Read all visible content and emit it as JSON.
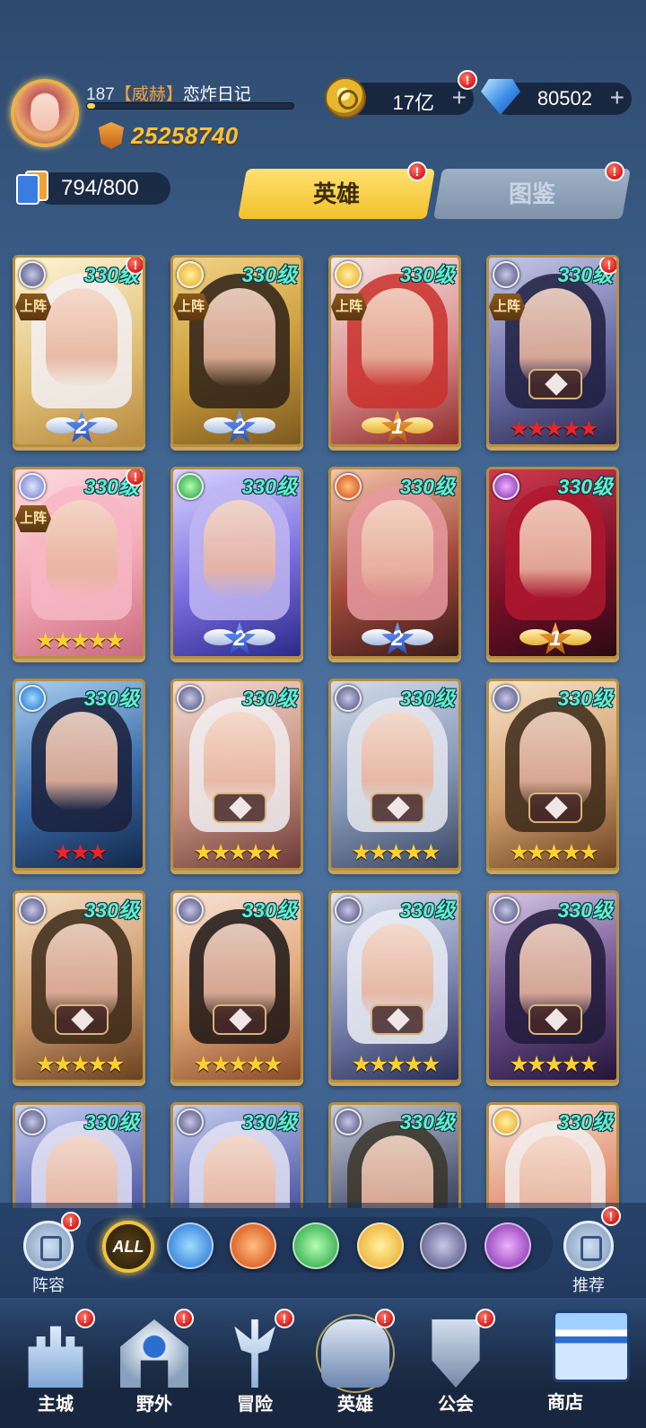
{
  "player": {
    "level": "187",
    "guild_tag": "【威赫】",
    "name": "恋炸日记",
    "xp_fraction": 0.04,
    "power": "25258740"
  },
  "currency": {
    "gold": "17亿",
    "gems": "80502",
    "plus": "+"
  },
  "collection": {
    "count": "794/800"
  },
  "tabs": [
    {
      "label": "英雄",
      "active": true
    },
    {
      "label": "图鉴",
      "active": false
    }
  ],
  "alert_glyph": "!",
  "heroes": [
    {
      "level": "330级",
      "element": "void-icon",
      "deployed": true,
      "deploy_label": "上阵",
      "rank_badge": "silver",
      "rank": "2",
      "alert": true,
      "tint": "#fff5d6,#e2c27a,#b88940",
      "hair": "#f3f1f6"
    },
    {
      "level": "330级",
      "element": "light-icon",
      "deployed": true,
      "deploy_label": "上阵",
      "rank_badge": "silver",
      "rank": "2",
      "alert": false,
      "tint": "#f2d48a,#c99a38,#7b5a20",
      "hair": "#2b2018"
    },
    {
      "level": "330级",
      "element": "light-icon",
      "deployed": true,
      "deploy_label": "上阵",
      "rank_badge": "gold",
      "rank": "1",
      "alert": false,
      "tint": "#f7e7e3,#d98e8e,#8f2a2a",
      "hair": "#c9302c"
    },
    {
      "level": "330级",
      "element": "void-icon",
      "deployed": true,
      "deploy_label": "上阵",
      "stars": "★★★★★",
      "star_color": "red",
      "emblem": true,
      "alert": true,
      "tint": "#c7c9e8,#6d6ea6,#2a2b52",
      "hair": "#1d1e3f"
    },
    {
      "level": "330级",
      "element": "sp-icon",
      "deployed": true,
      "deploy_label": "上阵",
      "stars": "★★★★★",
      "star_color": "gold",
      "alert": true,
      "tint": "#ffd9df,#f2a8b6,#c96a7e",
      "hair": "#f7b7c4"
    },
    {
      "level": "330级",
      "element": "wind-icon",
      "deployed": false,
      "rank_badge": "silver",
      "rank": "2",
      "alert": false,
      "tint": "#d9d4ff,#7c6ee0,#2a2a8a",
      "hair": "#bfb6f2"
    },
    {
      "level": "330级",
      "element": "fire-icon",
      "deployed": false,
      "rank_badge": "silver",
      "rank": "2",
      "alert": false,
      "tint": "#f6c4a8,#a24a3c,#3a1a1a",
      "hair": "#e89aa0"
    },
    {
      "level": "330级",
      "element": "dark-icon",
      "deployed": false,
      "rank_badge": "gold",
      "rank": "1",
      "alert": false,
      "tint": "#d03a4e,#7a1028,#2a0a14",
      "hair": "#b0182e"
    },
    {
      "level": "330级",
      "element": "water-icon",
      "deployed": false,
      "stars": "★★★",
      "star_color": "red",
      "alert": false,
      "tint": "#a8d0f2,#3a6aa8,#12284a",
      "hair": "#1a1f3a"
    },
    {
      "level": "330级",
      "element": "void-icon",
      "deployed": false,
      "stars": "★★★★★",
      "star_color": "gold",
      "emblem": true,
      "alert": false,
      "tint": "#f3dcd4,#c89080,#6a3a38",
      "hair": "#f2eef2"
    },
    {
      "level": "330级",
      "element": "void-icon",
      "deployed": false,
      "stars": "★★★★★",
      "star_color": "gold",
      "emblem": true,
      "alert": false,
      "tint": "#d4dcea,#8598b8,#3a4662",
      "hair": "#e6e8ee"
    },
    {
      "level": "330级",
      "element": "void-icon",
      "deployed": false,
      "stars": "★★★★★",
      "star_color": "gold",
      "emblem": true,
      "alert": false,
      "tint": "#f7e2c8,#d2a070,#6a4020",
      "hair": "#3a2818"
    },
    {
      "level": "330级",
      "element": "void-icon",
      "deployed": false,
      "stars": "★★★★★",
      "star_color": "gold",
      "emblem": true,
      "alert": false,
      "tint": "#f6dfc4,#cd9a6c,#6a4020",
      "hair": "#3a2818"
    },
    {
      "level": "330级",
      "element": "void-icon",
      "deployed": false,
      "stars": "★★★★★",
      "star_color": "gold",
      "emblem": true,
      "alert": false,
      "tint": "#f8e2d6,#e0a878,#8a4a28",
      "hair": "#1a1414"
    },
    {
      "level": "330级",
      "element": "void-icon",
      "deployed": false,
      "stars": "★★★★★",
      "star_color": "gold",
      "emblem": true,
      "alert": false,
      "tint": "#dfe4f0,#7a86b0,#2a2e58",
      "hair": "#eceef6"
    },
    {
      "level": "330级",
      "element": "void-icon",
      "deployed": false,
      "stars": "★★★★★",
      "star_color": "gold",
      "emblem": true,
      "alert": false,
      "tint": "#d6c8e6,#6a4e8a,#24143a",
      "hair": "#201a38"
    },
    {
      "level": "330级",
      "element": "void-icon",
      "deployed": false,
      "alert": false,
      "tint": "#c8cff0,#5a66b0,#202654",
      "hair": "#e4e2f4"
    },
    {
      "level": "330级",
      "element": "void-icon",
      "deployed": false,
      "alert": false,
      "tint": "#c8cff0,#5a66b0,#202654",
      "hair": "#e4e2f4"
    },
    {
      "level": "330级",
      "element": "void-icon",
      "deployed": false,
      "alert": false,
      "tint": "#c4cad8,#4a5270,#14182a",
      "hair": "#3a3428"
    },
    {
      "level": "330级",
      "element": "light-icon",
      "deployed": false,
      "alert": false,
      "tint": "#f7e4d8,#e08a6a,#a03a28",
      "hair": "#f2eeee"
    }
  ],
  "filters": {
    "all_label": "ALL",
    "lineup_label": "阵容",
    "recommend_label": "推荐",
    "elements": [
      "water-icon",
      "fire-icon",
      "wind-icon",
      "light-icon",
      "void-icon",
      "dark-icon"
    ]
  },
  "nav": [
    {
      "label": "主城",
      "icon": "castle-icon",
      "alert": true,
      "active": false
    },
    {
      "label": "野外",
      "icon": "wilds-gate-icon",
      "alert": true,
      "active": false
    },
    {
      "label": "冒险",
      "icon": "adventure-trident-icon",
      "alert": true,
      "active": false
    },
    {
      "label": "英雄",
      "icon": "hero-helmet-icon",
      "alert": true,
      "active": true
    },
    {
      "label": "公会",
      "icon": "guild-shield-icon",
      "alert": true,
      "active": false
    },
    {
      "label": "商店",
      "icon": "shop-icon",
      "alert": false,
      "active": false
    }
  ],
  "colors": {
    "level_text": "#5ff0c9",
    "power_text": "#f6c13d",
    "tab_active": "#f2c12c",
    "alert_red": "#d61c1c"
  }
}
